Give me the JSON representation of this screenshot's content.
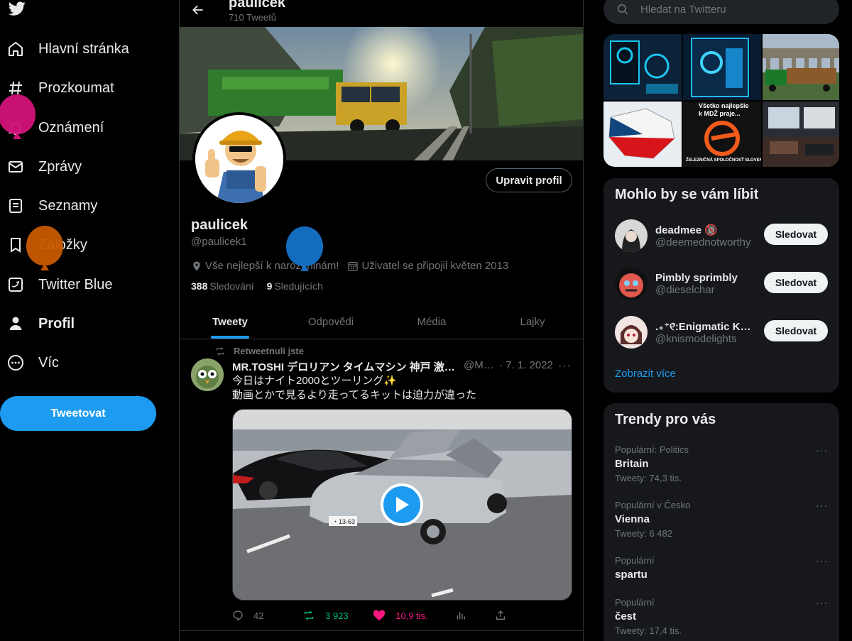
{
  "nav": {
    "items": [
      {
        "label": "Hlavní stránka",
        "icon": "home-icon"
      },
      {
        "label": "Prozkoumat",
        "icon": "hashtag-icon"
      },
      {
        "label": "Oznámení",
        "icon": "bell-icon"
      },
      {
        "label": "Zprávy",
        "icon": "envelope-icon"
      },
      {
        "label": "Seznamy",
        "icon": "list-icon"
      },
      {
        "label": "Záložky",
        "icon": "bookmark-icon"
      },
      {
        "label": "Twitter Blue",
        "icon": "twitter-blue-icon"
      },
      {
        "label": "Profil",
        "icon": "person-icon"
      },
      {
        "label": "Víc",
        "icon": "more-circle-icon"
      }
    ],
    "tweet_button": "Tweetovat"
  },
  "header": {
    "name": "paulicek",
    "tweet_count": "710 Tweetů"
  },
  "profile": {
    "name": "paulicek",
    "handle": "@paulicek1",
    "edit_button": "Upravit profil",
    "location": "Vše nejlepší k narozeninám!",
    "joined": "Uživatel se připojil květen 2013",
    "following_count": "388",
    "following_label": "Sledování",
    "followers_count": "9",
    "followers_label": "Sledujících"
  },
  "tabs": [
    "Tweety",
    "Odpovědi",
    "Média",
    "Lajky"
  ],
  "tweet": {
    "retweet_label": "Retweetnuli jste",
    "author": "MR.TOSHI デロリアン タイムマシン 神戸 激レア…",
    "handle": "@Mr_…",
    "date": "· 7. 1. 2022",
    "more": "···",
    "text_line1": "今日はナイト2000とツーリング✨",
    "text_line2": "動画とかで見るより走ってるキットは迫力が違った",
    "plate": "・13-63",
    "replies": "42",
    "retweets": "3 923",
    "likes": "10,9 tis."
  },
  "search": {
    "placeholder": "Hledat na Twitteru"
  },
  "gallery_texts": {
    "caption1": "Všetko najlepšie",
    "caption2": "k MDŽ praje...",
    "caption3": "ŽELEZNIČNÁ SPOLOČNOSŤ SLOVENSKO"
  },
  "who_to_follow": {
    "title": "Mohlo by se vám líbit",
    "users": [
      {
        "name": "deadmee 🔞",
        "handle": "@deemednotworthy",
        "button": "Sledovat"
      },
      {
        "name": "Pimbly sprimbly",
        "handle": "@dieselchar",
        "button": "Sledovat"
      },
      {
        "name": ".₊⁺୧̑:Enigmatic K…",
        "handle": "@knismodelights",
        "button": "Sledovat"
      }
    ],
    "show_more": "Zobrazit více"
  },
  "trends": {
    "title": "Trendy pro vás",
    "items": [
      {
        "context": "Populární: Politics",
        "name": "Britain",
        "count": "Tweety: 74,3 tis."
      },
      {
        "context": "Populární v Česko",
        "name": "Vienna",
        "count": "Tweety: 6 482"
      },
      {
        "context": "Populární",
        "name": "spartu",
        "count": ""
      },
      {
        "context": "Populární",
        "name": "čest",
        "count": "Tweety: 17,4 tis."
      }
    ]
  },
  "colors": {
    "accent": "#1d9bf0",
    "background": "#000000",
    "card": "#16181c",
    "retweet_green": "#00ba7c",
    "like_pink": "#f91880"
  }
}
